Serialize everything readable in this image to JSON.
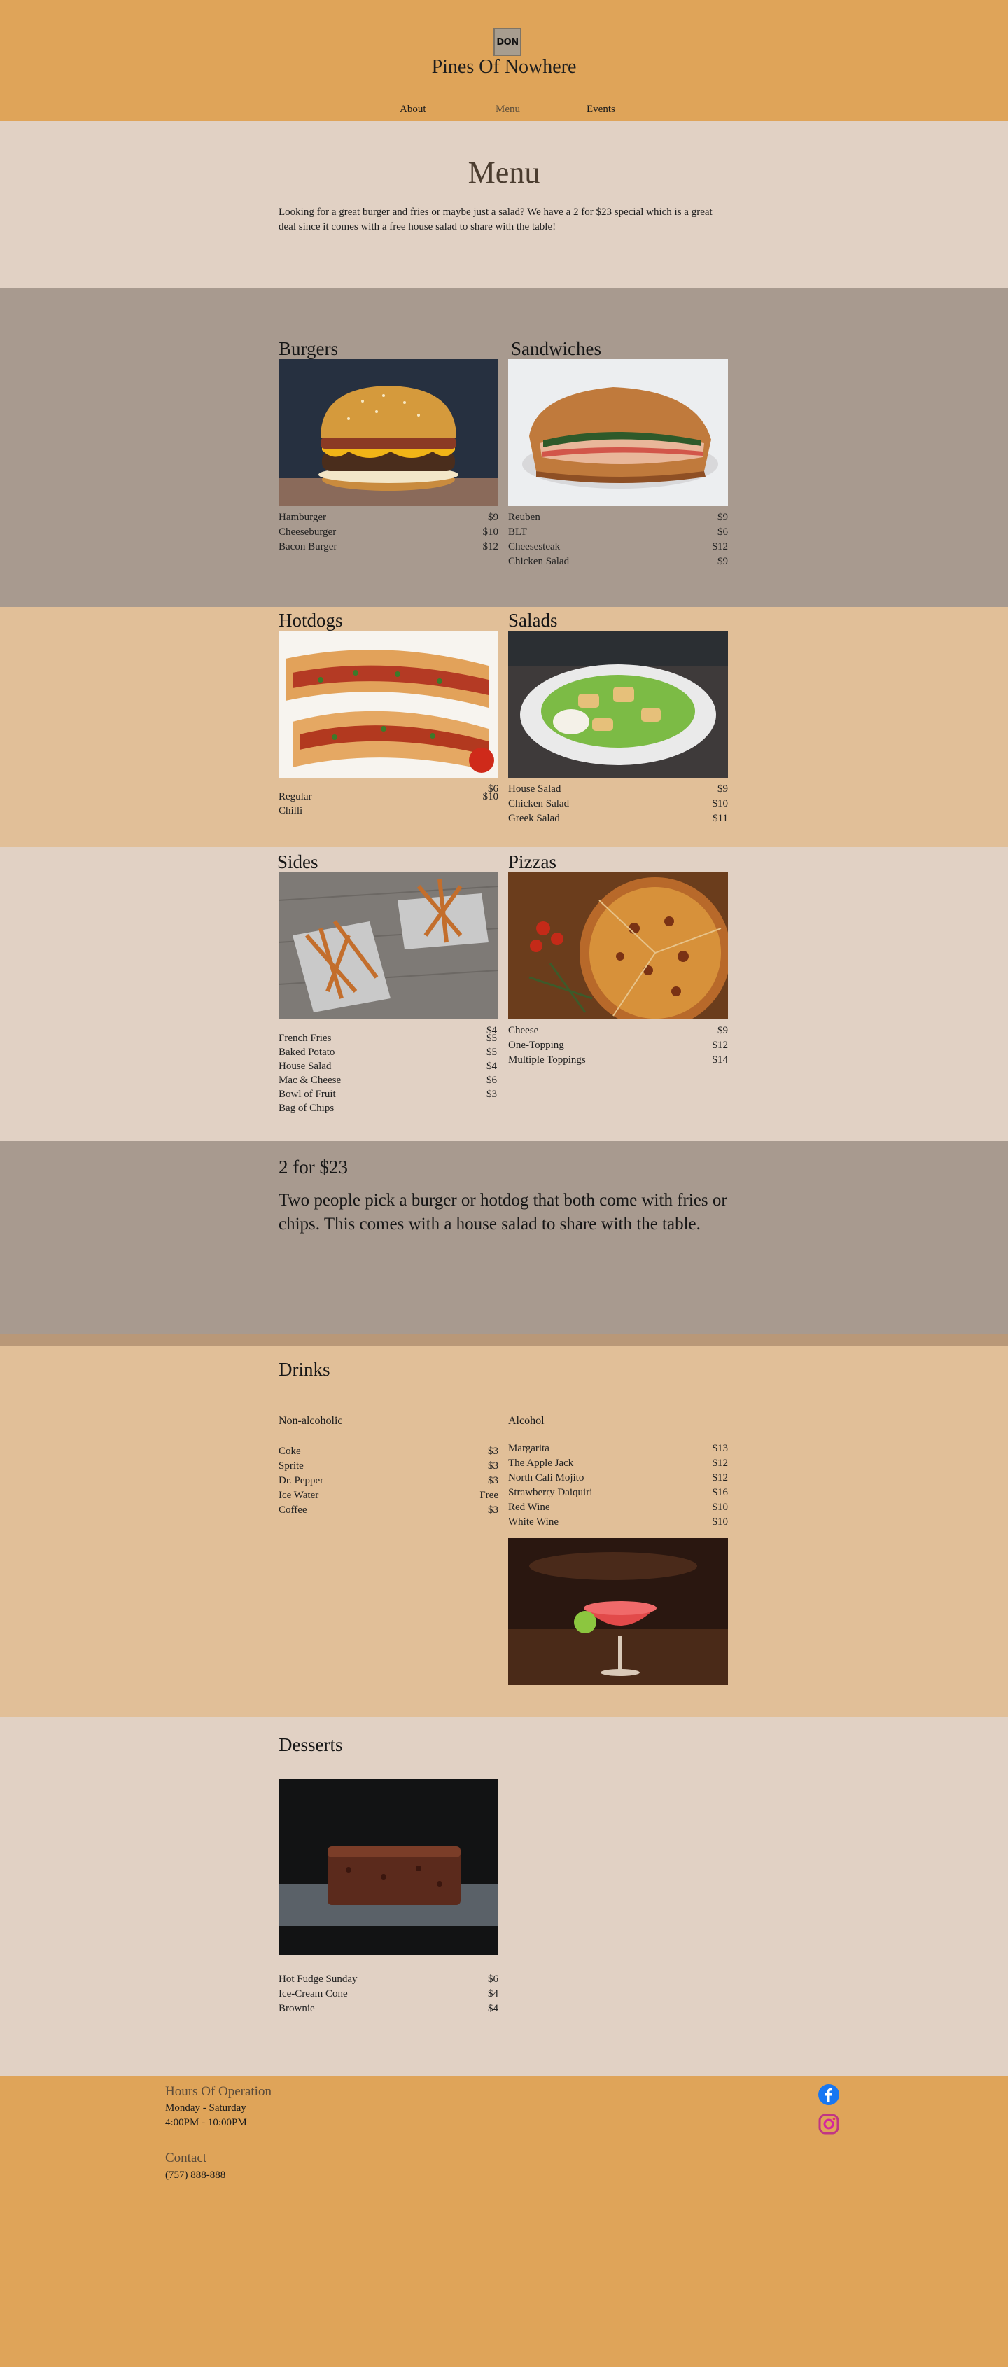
{
  "site": {
    "logo_text": "DON",
    "title": "Pines Of Nowhere"
  },
  "nav": [
    {
      "label": "About"
    },
    {
      "label": "Menu"
    },
    {
      "label": "Events"
    }
  ],
  "intro": {
    "heading": "Menu",
    "text": "Looking for a great burger and fries or maybe just a salad? We have a 2 for $23 special which is a great deal since it comes with a free house salad to share with the table!"
  },
  "burgers": {
    "title": "Burgers",
    "items": [
      {
        "name": "Hamburger",
        "price": "$9"
      },
      {
        "name": "Cheeseburger",
        "price": "$10"
      },
      {
        "name": "Bacon Burger",
        "price": "$12"
      }
    ]
  },
  "sandwiches": {
    "title": "Sandwiches",
    "items": [
      {
        "name": "Reuben",
        "price": "$9"
      },
      {
        "name": "BLT",
        "price": "$6"
      },
      {
        "name": "Cheesesteak",
        "price": "$12"
      },
      {
        "name": "Chicken Salad",
        "price": "$9"
      }
    ]
  },
  "hotdogs": {
    "title": "Hotdogs",
    "items": [
      {
        "name": "Regular",
        "price": "$6"
      },
      {
        "name": "Chilli",
        "price": "$10"
      }
    ]
  },
  "salads": {
    "title": "Salads",
    "items": [
      {
        "name": "House Salad",
        "price": "$9"
      },
      {
        "name": "Chicken Salad",
        "price": "$10"
      },
      {
        "name": "Greek Salad",
        "price": "$11"
      }
    ]
  },
  "sides": {
    "title": "Sides",
    "items": [
      {
        "name": "French Fries",
        "price": "$4"
      },
      {
        "name": "Baked Potato",
        "price": "$5"
      },
      {
        "name": "House Salad",
        "price": "$5"
      },
      {
        "name": "Mac & Cheese",
        "price": "$4"
      },
      {
        "name": "Bowl of Fruit",
        "price": "$6"
      },
      {
        "name": "Bag of Chips",
        "price": "$3"
      }
    ]
  },
  "pizzas": {
    "title": "Pizzas",
    "items": [
      {
        "name": "Cheese",
        "price": "$9"
      },
      {
        "name": "One-Topping",
        "price": "$12"
      },
      {
        "name": "Multiple Toppings",
        "price": "$14"
      }
    ]
  },
  "special": {
    "title": "2 for $23",
    "text": "Two people pick a burger or hotdog that both come with fries or chips. This comes with a house salad to share with the table."
  },
  "drinks": {
    "title": "Drinks",
    "non_alcoholic": {
      "title": "Non-alcoholic",
      "items": [
        {
          "name": "Coke",
          "price": "$3"
        },
        {
          "name": "Sprite",
          "price": "$3"
        },
        {
          "name": "Dr. Pepper",
          "price": "$3"
        },
        {
          "name": "Ice Water",
          "price": "Free"
        },
        {
          "name": "Coffee",
          "price": "$3"
        }
      ]
    },
    "alcohol": {
      "title": "Alcohol",
      "items": [
        {
          "name": "Margarita",
          "price": "$13"
        },
        {
          "name": "The Apple Jack",
          "price": "$12"
        },
        {
          "name": "North Cali Mojito",
          "price": "$12"
        },
        {
          "name": "Strawberry Daiquiri",
          "price": "$16"
        },
        {
          "name": "Red Wine",
          "price": "$10"
        },
        {
          "name": "White Wine",
          "price": "$10"
        }
      ]
    }
  },
  "desserts": {
    "title": "Desserts",
    "items": [
      {
        "name": "Hot Fudge Sunday",
        "price": "$6"
      },
      {
        "name": "Ice-Cream Cone",
        "price": "$4"
      },
      {
        "name": "Brownie",
        "price": "$4"
      }
    ]
  },
  "footer": {
    "hours_title": "Hours Of Operation",
    "days": "Monday - Saturday",
    "hours": "4:00PM - 10:00PM",
    "contact_title": "Contact",
    "phone": "(757) 888-888"
  },
  "colors": {
    "header": "#dfa459",
    "light_band": "#e1d1c4",
    "gray_band": "#a89a8f",
    "tan_band": "#e1bf98"
  },
  "icons": {
    "facebook": "facebook-icon",
    "instagram": "instagram-icon"
  }
}
